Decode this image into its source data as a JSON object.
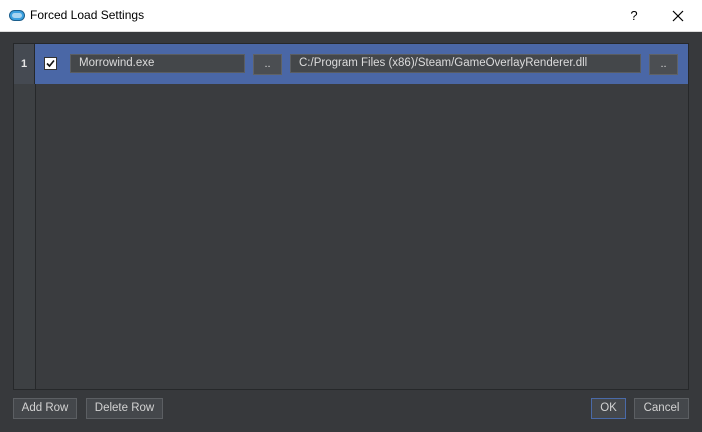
{
  "window": {
    "title": "Forced Load Settings",
    "help_label": "?"
  },
  "table": {
    "rows": [
      {
        "number": "1",
        "enabled": true,
        "executable": "Morrowind.exe",
        "browse_exe_label": "..",
        "library": "C:/Program Files (x86)/Steam/GameOverlayRenderer.dll",
        "browse_lib_label": ".."
      }
    ]
  },
  "footer": {
    "add_row_label": "Add Row",
    "delete_row_label": "Delete Row",
    "ok_label": "OK",
    "cancel_label": "Cancel"
  },
  "colors": {
    "selection": "#4a67a6",
    "background": "#37393c",
    "app_icon": "#3aa0e0"
  }
}
